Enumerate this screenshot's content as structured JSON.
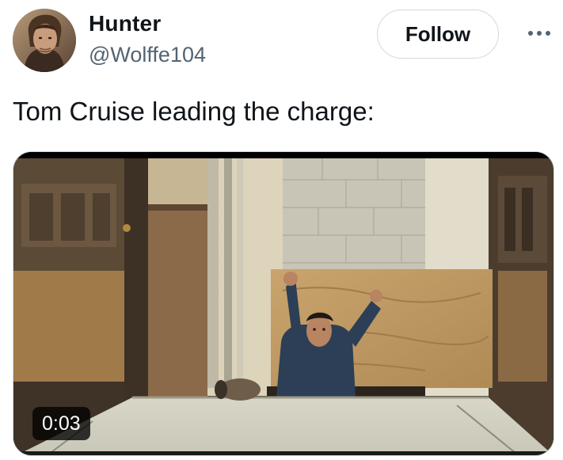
{
  "author": {
    "display_name": "Hunter",
    "handle": "@Wolffe104"
  },
  "actions": {
    "follow_label": "Follow",
    "more_icon": "more-horizontal-icon"
  },
  "tweet": {
    "text": "Tom Cruise leading the charge:"
  },
  "media": {
    "type": "video",
    "duration": "0:03"
  },
  "colors": {
    "text_primary": "#0f1419",
    "text_secondary": "#536471",
    "border": "#cfd9de"
  }
}
